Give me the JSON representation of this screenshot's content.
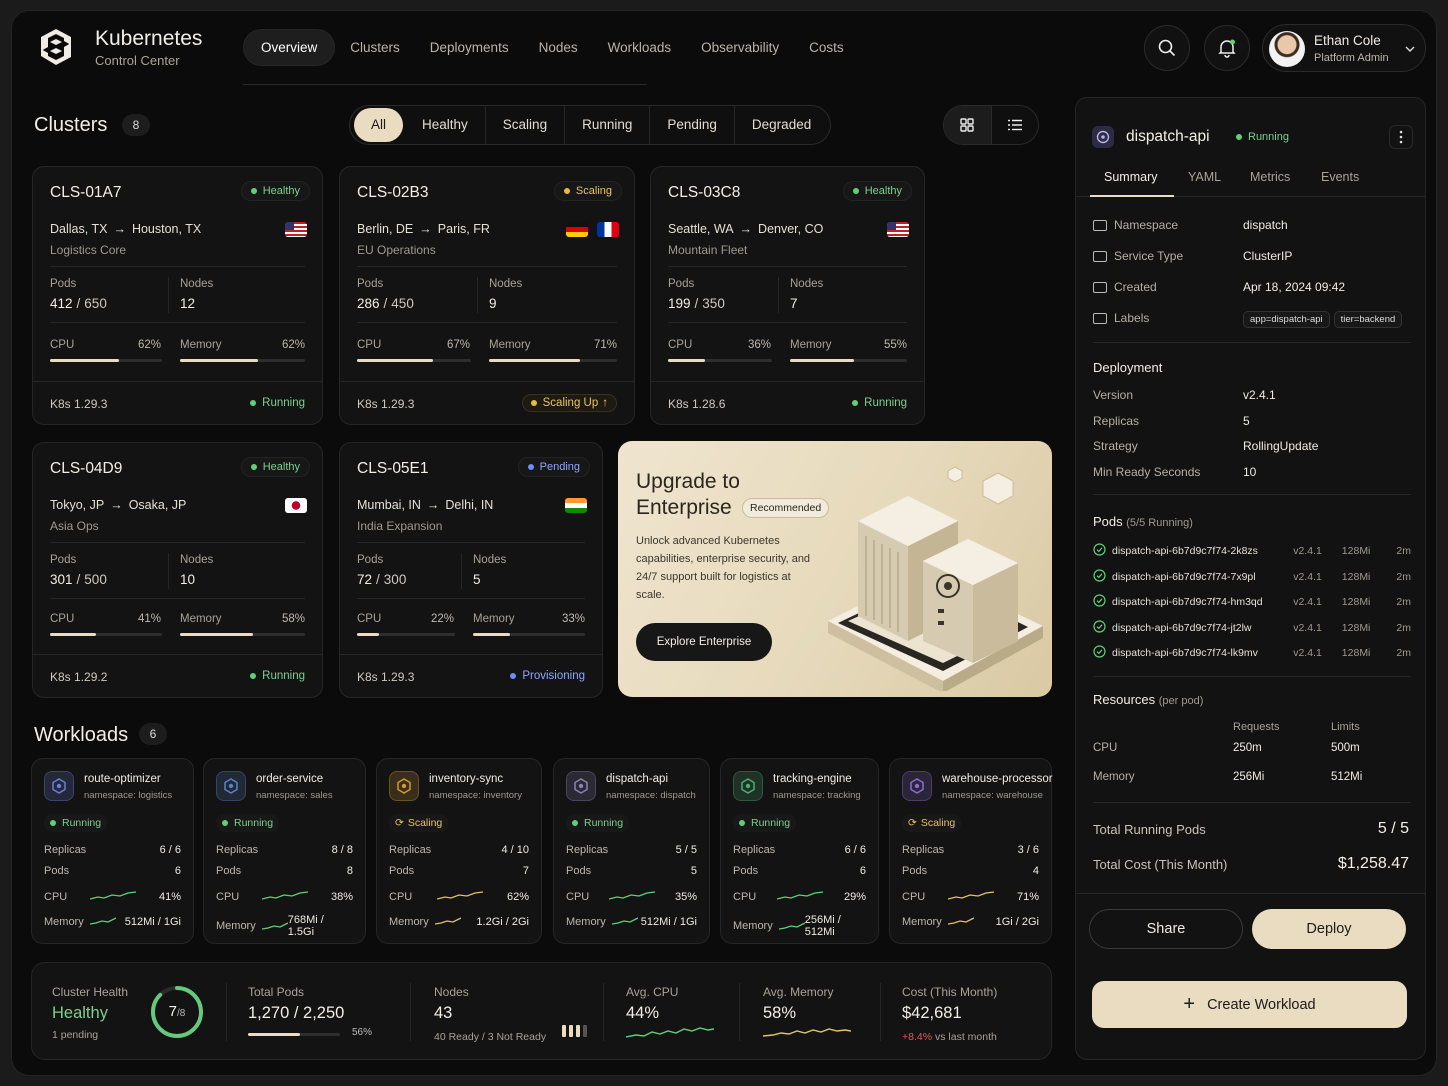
{
  "brand": {
    "title": "Kubernetes",
    "subtitle": "Control Center"
  },
  "nav": [
    "Overview",
    "Clusters",
    "Deployments",
    "Nodes",
    "Workloads",
    "Observability",
    "Costs"
  ],
  "user": {
    "name": "Ethan Cole",
    "role": "Platform Admin"
  },
  "clusters_section": {
    "title": "Clusters",
    "count": "8",
    "filters": [
      "All",
      "Healthy",
      "Scaling",
      "Running",
      "Pending",
      "Degraded"
    ]
  },
  "clusters": [
    {
      "id": "CLS-01A7",
      "status": "Healthy",
      "from": "Dallas, TX",
      "to": "Houston, TX",
      "region": "Logistics Core",
      "pods": "412",
      "pods_max": "650",
      "nodes": "12",
      "cpu": "62%",
      "cpu_frac": 0.62,
      "mem": "62%",
      "mem_frac": 0.62,
      "cpu_label": "",
      "version": "K8s 1.29.3",
      "run": "Running"
    },
    {
      "id": "CLS-02B3",
      "status": "Scaling",
      "from": "Berlin, DE",
      "to": "Paris, FR",
      "region": "EU Operations",
      "pods": "286",
      "pods_max": "450",
      "nodes": "9",
      "cpu": "67%",
      "cpu_frac": 0.67,
      "mem": "71%",
      "mem_frac": 0.71,
      "version": "K8s 1.29.3",
      "run": "Scaling Up"
    },
    {
      "id": "CLS-03C8",
      "status": "Healthy",
      "from": "Seattle, WA",
      "to": "Denver, CO",
      "region": "Mountain Fleet",
      "pods": "199",
      "pods_max": "350",
      "nodes": "7",
      "cpu": "36%",
      "cpu_frac": 0.36,
      "mem": "55%",
      "mem_frac": 0.55,
      "version": "K8s 1.28.6",
      "run": "Running"
    },
    {
      "id": "CLS-04D9",
      "status": "Healthy",
      "from": "Tokyo, JP",
      "to": "Osaka, JP",
      "region": "Asia Ops",
      "pods": "301",
      "pods_max": "500",
      "nodes": "10",
      "cpu": "41%",
      "cpu_frac": 0.41,
      "mem": "58%",
      "mem_frac": 0.58,
      "version": "K8s 1.29.2",
      "run": "Running"
    },
    {
      "id": "CLS-05E1",
      "status": "Pending",
      "from": "Mumbai, IN",
      "to": "Delhi, IN",
      "region": "India Expansion",
      "pods": "72",
      "pods_max": "300",
      "nodes": "5",
      "cpu": "22%",
      "cpu_frac": 0.22,
      "mem": "33%",
      "mem_frac": 0.33,
      "version": "K8s 1.29.3",
      "run": "Provisioning"
    }
  ],
  "labels": {
    "pods": "Pods",
    "nodes": "Nodes",
    "cpu": "CPU",
    "memory": "Memory",
    "replicas": "Replicas",
    "slash": "/"
  },
  "promo": {
    "title1": "Upgrade to",
    "title2": "Enterprise",
    "badge": "Recommended",
    "text": "Unlock advanced Kubernetes capabilities, enterprise security, and 24/7 support built for logistics at scale.",
    "button": "Explore Enterprise"
  },
  "workloads_section": {
    "title": "Workloads",
    "count": "6"
  },
  "workloads": [
    {
      "name": "route-optimizer",
      "ns": "namespace: logistics",
      "status": "Running",
      "replicas": "6 / 6",
      "pods": "6",
      "cpu": "41%",
      "mem": "512Mi / 1Gi",
      "color": "#6a7fd9"
    },
    {
      "name": "order-service",
      "ns": "namespace: sales",
      "status": "Running",
      "replicas": "8 / 8",
      "pods": "8",
      "cpu": "38%",
      "mem": "768Mi / 1.5Gi",
      "color": "#5a82c9"
    },
    {
      "name": "inventory-sync",
      "ns": "namespace: inventory",
      "status": "Scaling",
      "replicas": "4 / 10",
      "pods": "7",
      "cpu": "62%",
      "mem": "1.2Gi / 2Gi",
      "color": "#d29a36"
    },
    {
      "name": "dispatch-api",
      "ns": "namespace: dispatch",
      "status": "Running",
      "replicas": "5 / 5",
      "pods": "5",
      "cpu": "35%",
      "mem": "512Mi / 1Gi",
      "color": "#8a82b8"
    },
    {
      "name": "tracking-engine",
      "ns": "namespace: tracking",
      "status": "Running",
      "replicas": "6 / 6",
      "pods": "6",
      "cpu": "29%",
      "mem": "256Mi / 512Mi",
      "color": "#4fae72"
    },
    {
      "name": "warehouse-processor",
      "ns": "namespace: warehouse",
      "status": "Scaling",
      "replicas": "3 / 6",
      "pods": "4",
      "cpu": "71%",
      "mem": "1Gi / 2Gi",
      "color": "#8a6ed1"
    }
  ],
  "stats": {
    "health": {
      "label": "Cluster Health",
      "value": "Healthy",
      "sub": "1 pending",
      "ring": "7",
      "ring_total": "/8",
      "frac": 0.875
    },
    "pods": {
      "label": "Total Pods",
      "value": "1,270 / 2,250",
      "pct": "56%",
      "frac": 0.56
    },
    "nodes": {
      "label": "Nodes",
      "value": "43",
      "sub": "40 Ready / 3 Not Ready"
    },
    "cpu": {
      "label": "Avg. CPU",
      "value": "44%"
    },
    "mem": {
      "label": "Avg. Memory",
      "value": "58%"
    },
    "cost": {
      "label": "Cost (This Month)",
      "value": "$42,681",
      "delta": "+8.4%",
      "delta_sub": "vs last month"
    }
  },
  "panel": {
    "name": "dispatch-api",
    "status": "Running",
    "tabs": [
      "Summary",
      "YAML",
      "Metrics",
      "Events"
    ],
    "meta": [
      {
        "k": "Namespace",
        "v": "dispatch"
      },
      {
        "k": "Service Type",
        "v": "ClusterIP"
      },
      {
        "k": "Created",
        "v": "Apr 18, 2024 09:42"
      },
      {
        "k": "Labels",
        "v": ""
      }
    ],
    "tags": [
      "app=dispatch-api",
      "tier=backend"
    ],
    "deployment_title": "Deployment",
    "deployment": [
      {
        "k": "Version",
        "v": "v2.4.1"
      },
      {
        "k": "Replicas",
        "v": "5"
      },
      {
        "k": "Strategy",
        "v": "RollingUpdate"
      },
      {
        "k": "Min Ready Seconds",
        "v": "10"
      }
    ],
    "pods_title": "Pods",
    "pods_sub": "(5/5 Running)",
    "pods": [
      {
        "n": "dispatch-api-6b7d9c7f74-2k8zs",
        "v": "v2.4.1",
        "m": "128Mi",
        "a": "2m"
      },
      {
        "n": "dispatch-api-6b7d9c7f74-7x9pl",
        "v": "v2.4.1",
        "m": "128Mi",
        "a": "2m"
      },
      {
        "n": "dispatch-api-6b7d9c7f74-hm3qd",
        "v": "v2.4.1",
        "m": "128Mi",
        "a": "2m"
      },
      {
        "n": "dispatch-api-6b7d9c7f74-jt2lw",
        "v": "v2.4.1",
        "m": "128Mi",
        "a": "2m"
      },
      {
        "n": "dispatch-api-6b7d9c7f74-lk9mv",
        "v": "v2.4.1",
        "m": "128Mi",
        "a": "2m"
      }
    ],
    "resources_title": "Resources",
    "resources_sub": "(per pod)",
    "res_headers": [
      "Requests",
      "Limits"
    ],
    "resources": [
      {
        "k": "CPU",
        "req": "250m",
        "lim": "500m"
      },
      {
        "k": "Memory",
        "req": "256Mi",
        "lim": "512Mi"
      }
    ],
    "total_pods_label": "Total Running Pods",
    "total_pods": "5 / 5",
    "total_cost_label": "Total Cost (This Month)",
    "total_cost": "$1,258.47",
    "share": "Share",
    "deploy": "Deploy",
    "create": "Create Workload"
  }
}
